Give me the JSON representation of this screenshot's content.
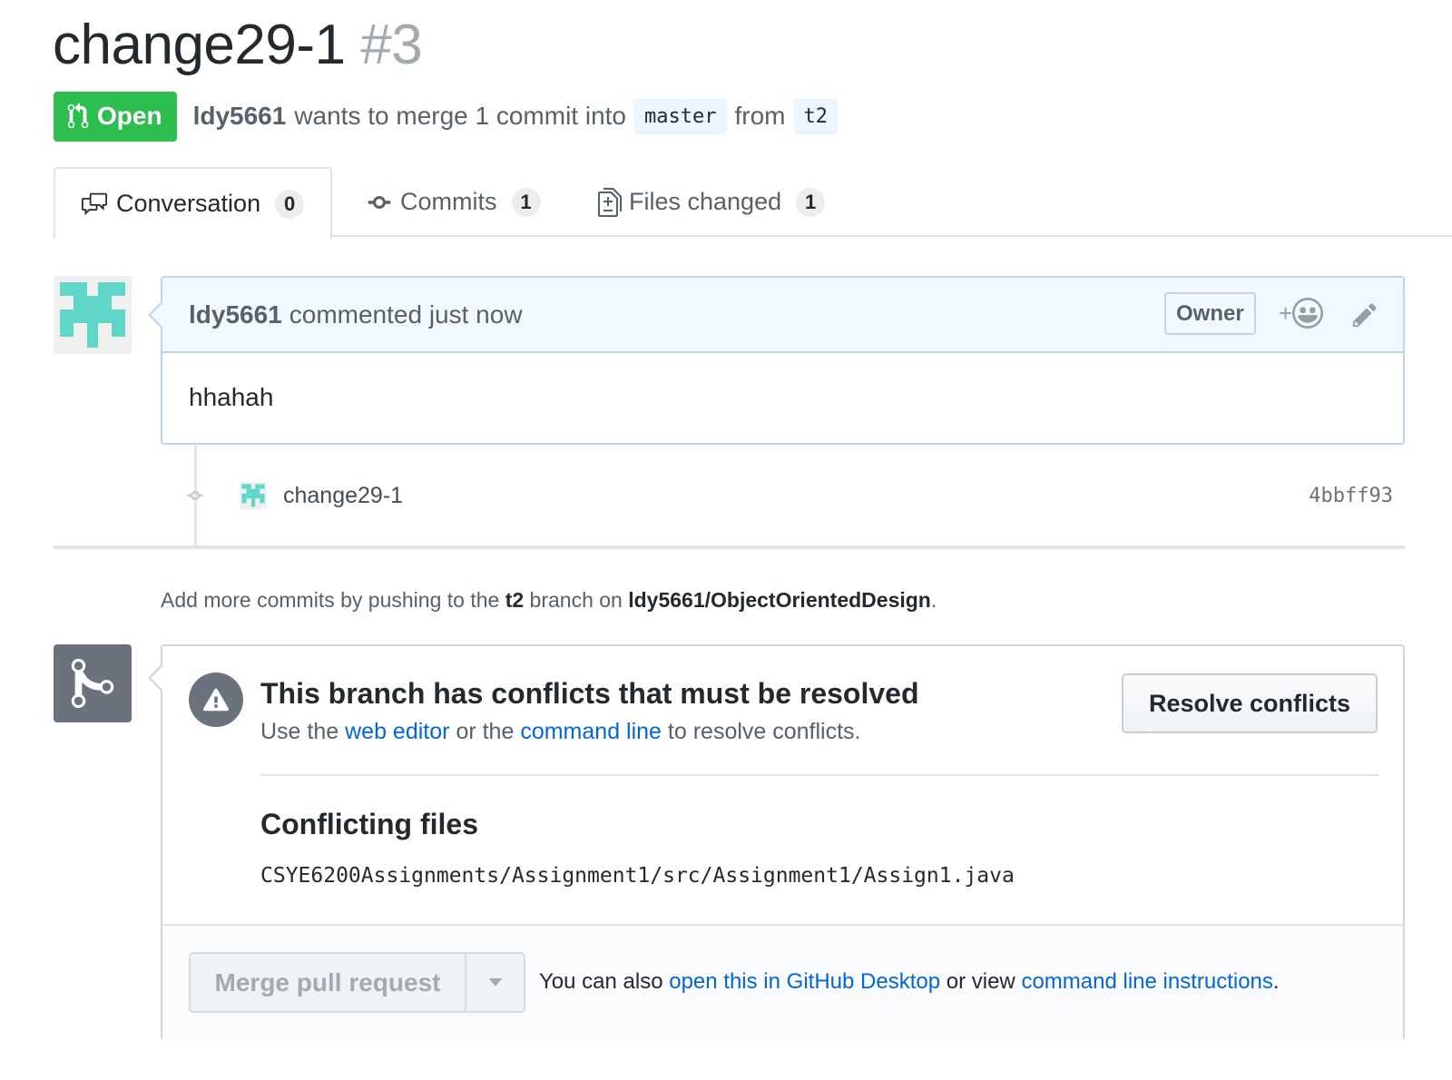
{
  "pr": {
    "title": "change29-1",
    "number": "#3",
    "state": "Open",
    "author": "ldy5661",
    "merge_text": "wants to merge 1 commit into",
    "base_branch": "master",
    "from_text": "from",
    "head_branch": "t2"
  },
  "tabs": [
    {
      "label": "Conversation",
      "count": "0",
      "icon": "comment-discussion-icon",
      "selected": true
    },
    {
      "label": "Commits",
      "count": "1",
      "icon": "git-commit-icon",
      "selected": false
    },
    {
      "label": "Files changed",
      "count": "1",
      "icon": "diff-icon",
      "selected": false
    }
  ],
  "comment": {
    "author": "ldy5661",
    "action": "commented just now",
    "role_badge": "Owner",
    "reaction_plus": "+",
    "body": "hhahah"
  },
  "commit": {
    "message": "change29-1",
    "sha": "4bbff93"
  },
  "hint": {
    "prefix": "Add more commits by pushing to the",
    "branch": "t2",
    "middle": "branch on",
    "repo": "ldy5661/ObjectOrientedDesign",
    "suffix": "."
  },
  "merge": {
    "title": "This branch has conflicts that must be resolved",
    "sub_prefix": "Use the",
    "web_editor": "web editor",
    "sub_middle": "or the",
    "command_line": "command line",
    "sub_suffix": "to resolve conflicts.",
    "resolve_button": "Resolve conflicts",
    "conflicting_title": "Conflicting files",
    "conflicting_file": "CSYE6200Assignments/Assignment1/src/Assignment1/Assign1.java",
    "merge_button": "Merge pull request",
    "footer_prefix": "You can also",
    "desktop_link": "open this in GitHub Desktop",
    "footer_middle": "or view",
    "cli_link": "command line instructions",
    "footer_suffix": "."
  },
  "colors": {
    "open_green": "#2cbe4e",
    "link_blue": "#0366d6",
    "comment_header_bg": "#f1f8ff",
    "avatar_teal": "#5fd6c8"
  }
}
